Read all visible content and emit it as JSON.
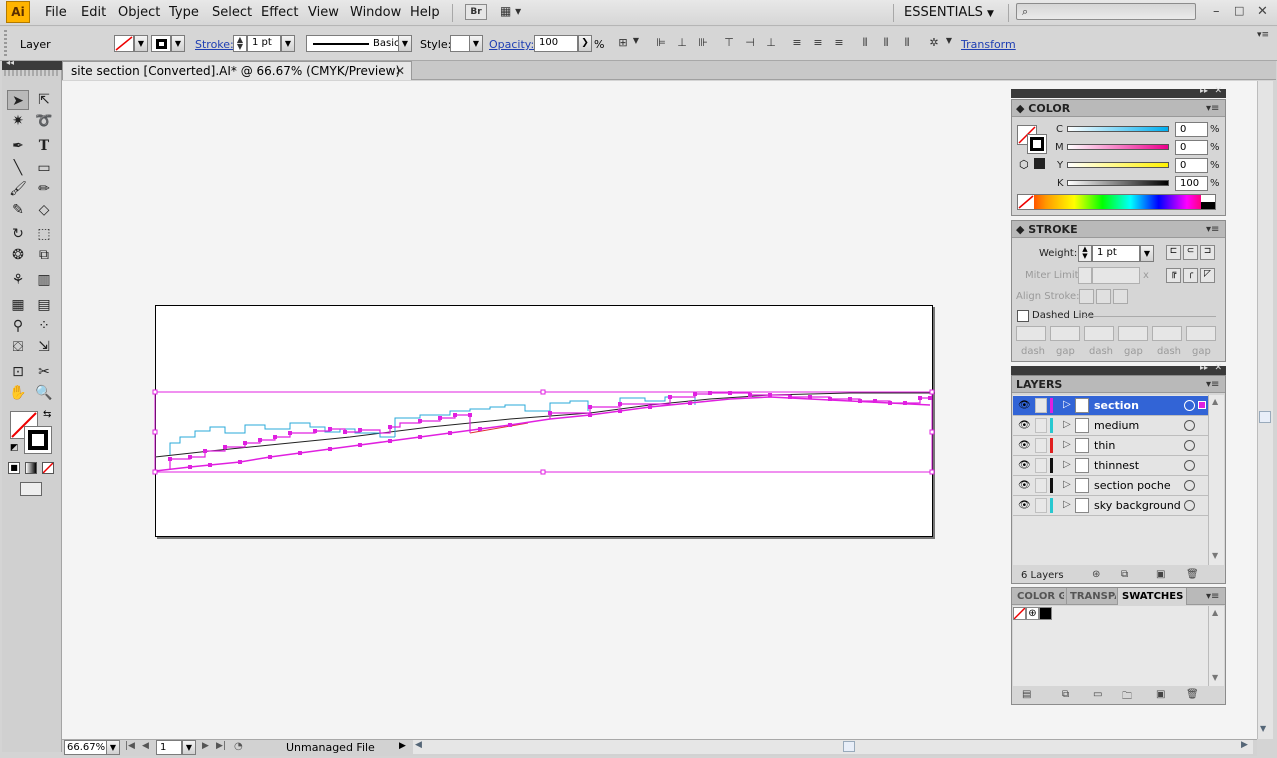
{
  "app": {
    "logo": "Ai",
    "menus": [
      "File",
      "Edit",
      "Object",
      "Type",
      "Select",
      "Effect",
      "View",
      "Window",
      "Help"
    ],
    "bridge_label": "Br",
    "workspace": "ESSENTIALS",
    "search_placeholder": "",
    "window_controls": [
      "–",
      "□",
      "✕"
    ]
  },
  "control_bar": {
    "selection_label": "Layer",
    "stroke_label": "Stroke:",
    "stroke_weight": "1 pt",
    "brush_label": "Basic",
    "style_label": "Style:",
    "opacity_label": "Opacity:",
    "opacity_value": "100",
    "opacity_unit": "%",
    "transform_label": "Transform"
  },
  "document": {
    "tab_title": "site section [Converted].AI* @ 66.67% (CMYK/Preview)",
    "tab_close": "✕"
  },
  "status": {
    "zoom": "66.67%",
    "page": "1",
    "info": "Unmanaged File"
  },
  "color_panel": {
    "title": "COLOR",
    "channels": [
      {
        "label": "C",
        "value": "0",
        "unit": "%"
      },
      {
        "label": "M",
        "value": "0",
        "unit": "%"
      },
      {
        "label": "Y",
        "value": "0",
        "unit": "%"
      },
      {
        "label": "K",
        "value": "100",
        "unit": "%"
      }
    ]
  },
  "stroke_panel": {
    "title": "STROKE",
    "weight_label": "Weight:",
    "weight_value": "1 pt",
    "miter_label": "Miter Limit:",
    "miter_unit": "x",
    "align_label": "Align Stroke:",
    "dashed_label": "Dashed Line",
    "dash_labels": [
      "dash",
      "gap",
      "dash",
      "gap",
      "dash",
      "gap"
    ]
  },
  "layers_panel": {
    "title": "LAYERS",
    "count_label": "6 Layers",
    "layers": [
      {
        "name": "section",
        "color": "#e020e0",
        "active": true
      },
      {
        "name": "medium",
        "color": "#28c8d0",
        "active": false
      },
      {
        "name": "thin",
        "color": "#e02020",
        "active": false
      },
      {
        "name": "thinnest",
        "color": "#111111",
        "active": false
      },
      {
        "name": "section poche",
        "color": "#111111",
        "active": false
      },
      {
        "name": "sky background",
        "color": "#28c8d0",
        "active": false
      }
    ]
  },
  "bottom_panel": {
    "tabs": [
      "COLOR G",
      "TRANSPA",
      "SWATCHES"
    ],
    "active_tab": "SWATCHES"
  },
  "colors": {
    "selection": "#e020e0",
    "cyan_buildings": "#2aa8d8",
    "red_line": "#e03030",
    "active_layer": "#3264d6"
  }
}
